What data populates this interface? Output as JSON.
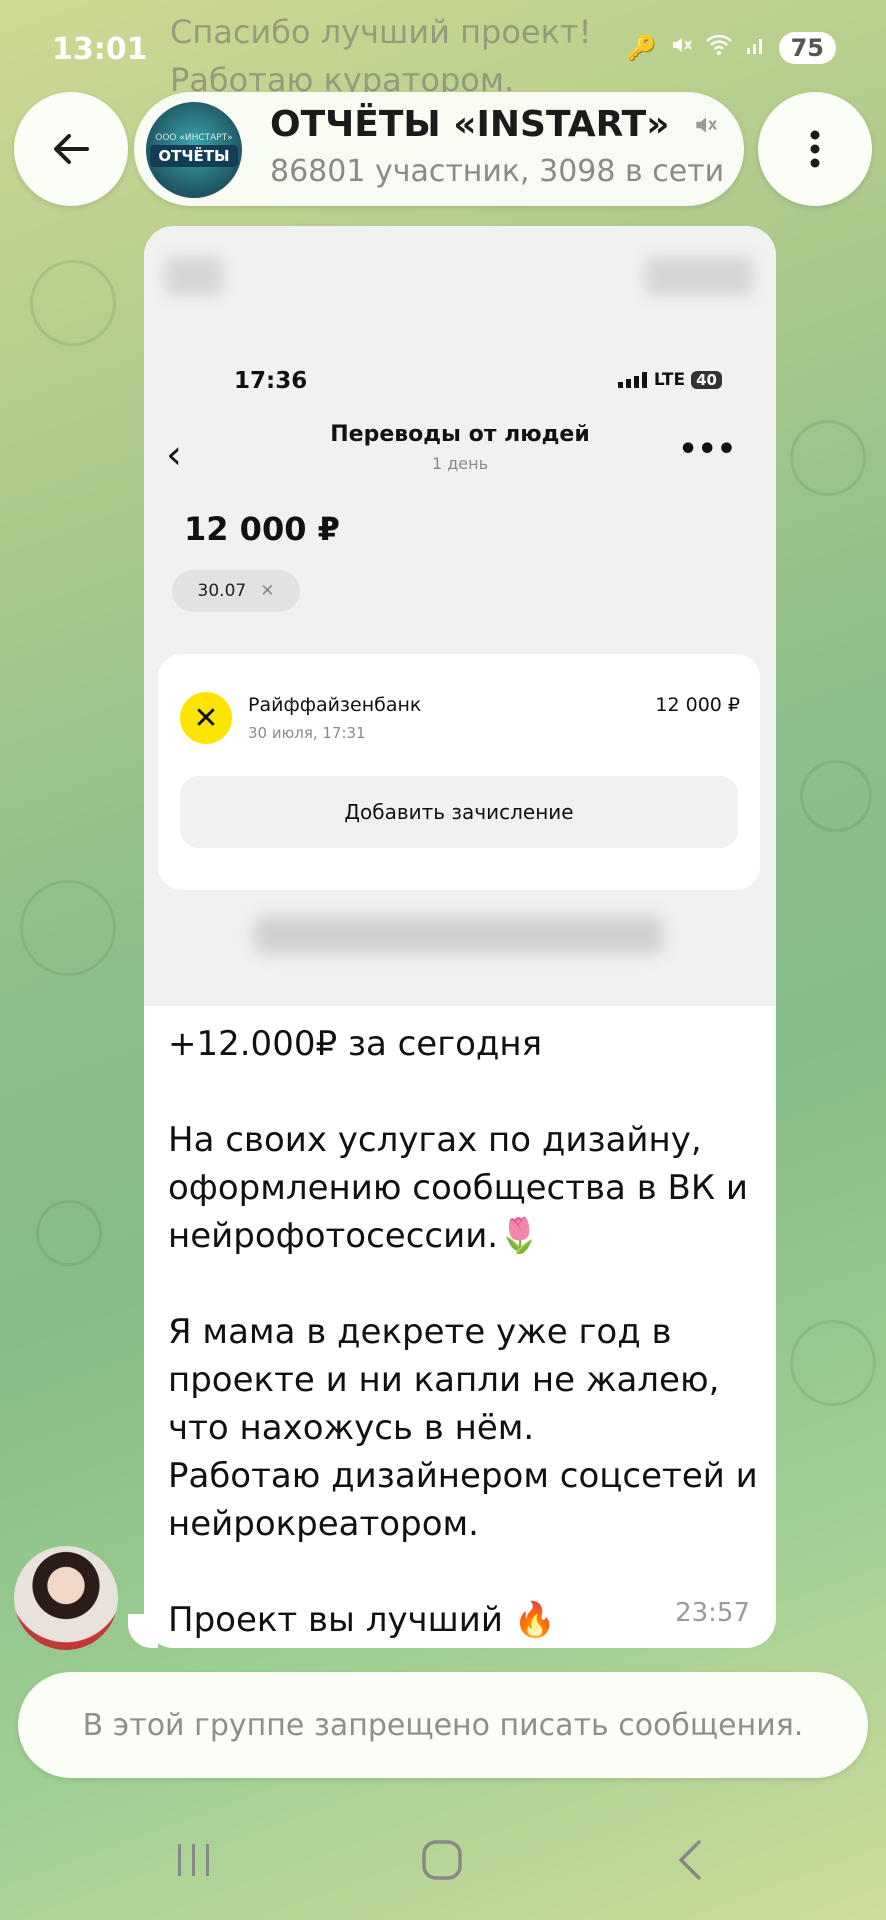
{
  "status_bar": {
    "time": "13:01",
    "battery": "75",
    "ghost_text_1": "Спасибо лучший проект! ",
    "ghost_text_2": "Работаю куратором."
  },
  "header": {
    "title": "ОТЧЁТЫ «INSTART»",
    "subtitle": "86801 участник, 3098 в сети",
    "avatar_label": "ОТЧЁТЫ",
    "avatar_top": "ООО «ИНСТАРТ»"
  },
  "screenshot": {
    "time": "17:36",
    "network": "LTE",
    "battery": "40",
    "title": "Переводы от людей",
    "subtitle": "1 день",
    "amount": "12 000 ₽",
    "chip_label": "30.07",
    "bank_name": "Райффайзенбанк",
    "bank_date": "30 июля, 17:31",
    "bank_amount": "12 000 ₽",
    "add_button": "Добавить зачисление"
  },
  "message": {
    "text": "+12.000₽ за сегодня\n\nНа своих услугах по дизайну, оформлению сообщества в ВК и нейрофотосессии.🌷\n\nЯ мама в декрете уже год в проекте и ни капли не жалею, что нахожусь в нём.\nРаботаю дизайнером соцсетей и нейрокреатором.\n\nПроект вы лучший 🔥",
    "time": "23:57"
  },
  "input_bar": {
    "text": "В этой группе запрещено писать сообщения."
  },
  "colors": {
    "bubble": "#ffffff",
    "background": "#8dbf8a",
    "raiffeisen": "#fde500"
  }
}
